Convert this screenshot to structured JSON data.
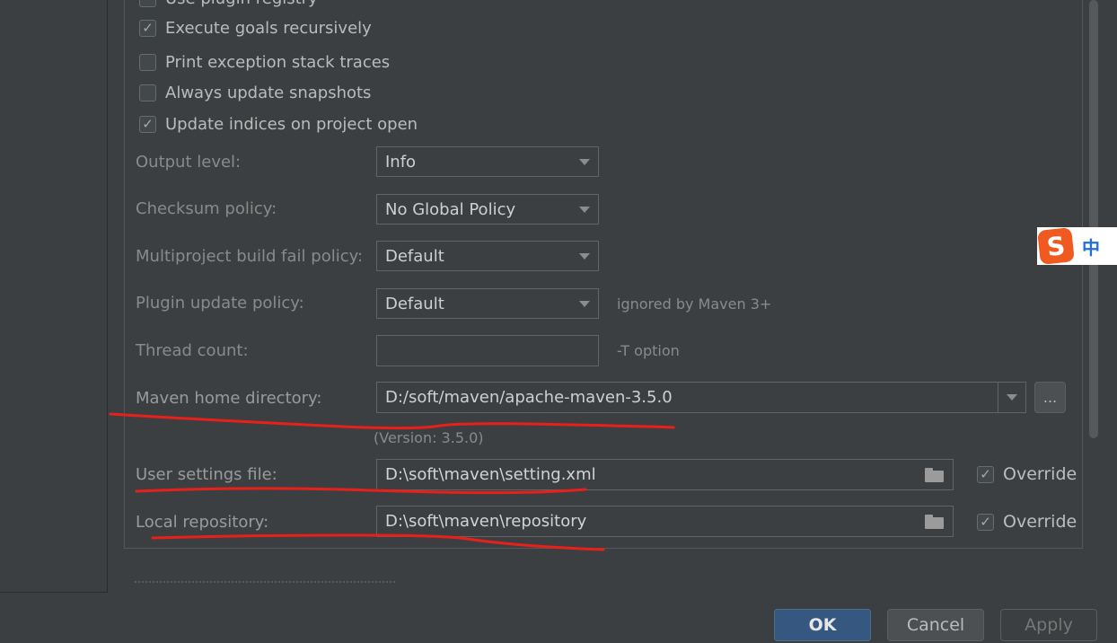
{
  "checkboxes": [
    {
      "label": "Use plugin registry",
      "checked": false
    },
    {
      "label": "Execute goals recursively",
      "checked": true
    },
    {
      "label": "Print exception stack traces",
      "checked": false
    },
    {
      "label": "Always update snapshots",
      "checked": false
    },
    {
      "label": "Update indices on project open",
      "checked": true
    }
  ],
  "fields": {
    "output_level": {
      "label": "Output level:",
      "value": "Info"
    },
    "checksum_policy": {
      "label": "Checksum policy:",
      "value": "No Global Policy"
    },
    "multiproject_fail_policy": {
      "label": "Multiproject build fail policy:",
      "value": "Default"
    },
    "plugin_update_policy": {
      "label": "Plugin update policy:",
      "value": "Default",
      "hint": "ignored by Maven 3+"
    },
    "thread_count": {
      "label": "Thread count:",
      "value": "",
      "hint": "-T option"
    },
    "maven_home": {
      "label": "Maven home directory:",
      "value": "D:/soft/maven/apache-maven-3.5.0",
      "version": "(Version: 3.5.0)",
      "browse_label": "..."
    },
    "user_settings": {
      "label": "User settings file:",
      "value": "D:\\soft\\maven\\setting.xml",
      "override_label": "Override",
      "override_checked": true
    },
    "local_repository": {
      "label": "Local repository:",
      "value": "D:\\soft\\maven\\repository",
      "override_label": "Override",
      "override_checked": true
    }
  },
  "buttons": {
    "ok": "OK",
    "cancel": "Cancel",
    "apply": "Apply"
  },
  "ime": {
    "logo": "S",
    "mode": "中"
  },
  "colors": {
    "annotation_red": "#e8201a",
    "ok_blue": "#365880",
    "background": "#3c3f41"
  }
}
